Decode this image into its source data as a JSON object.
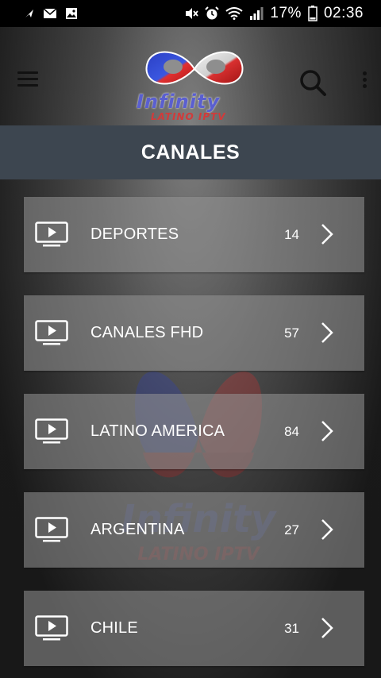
{
  "status_bar": {
    "battery_percent": "17%",
    "time": "02:36",
    "left_icons": [
      "navigation-icon",
      "mail-icon",
      "image-icon"
    ],
    "right_icons": [
      "mute-icon",
      "alarm-icon",
      "wifi-icon",
      "signal-icon",
      "battery-icon"
    ]
  },
  "header": {
    "logo_text": "Infinity",
    "logo_subtext": "LATINO IPTV",
    "menu_icon": "hamburger-menu-icon",
    "search_icon": "search-icon",
    "more_icon": "more-vert-icon"
  },
  "title": "CANALES",
  "channels": [
    {
      "label": "DEPORTES",
      "count": "14",
      "icon": "tv-play-icon"
    },
    {
      "label": "CANALES FHD",
      "count": "57",
      "icon": "tv-play-icon"
    },
    {
      "label": "LATINO AMERICA",
      "count": "84",
      "icon": "tv-play-icon"
    },
    {
      "label": "ARGENTINA",
      "count": "27",
      "icon": "tv-play-icon"
    },
    {
      "label": "CHILE",
      "count": "31",
      "icon": "tv-play-icon"
    }
  ],
  "colors": {
    "title_bar": "#3d4650",
    "status_bar": "#000000",
    "item_background": "#969696",
    "logo_blue": "#2a3fc4",
    "logo_red": "#d23a3a"
  }
}
